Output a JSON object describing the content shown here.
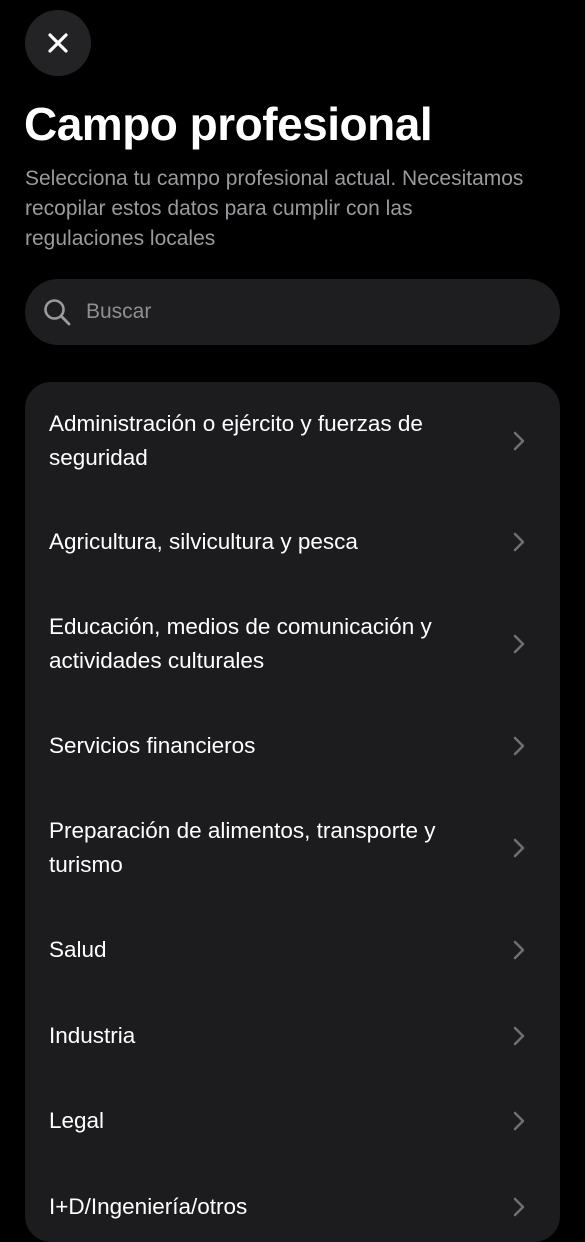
{
  "header": {
    "close_icon": "close-icon",
    "title": "Campo profesional",
    "subtitle": "Selecciona tu campo profesional actual. Necesitamos recopilar estos datos para cumplir con las regulaciones locales"
  },
  "search": {
    "icon": "search-icon",
    "placeholder": "Buscar",
    "value": ""
  },
  "fields": {
    "items": [
      {
        "label": "Administración o ejército y fuerzas de seguridad"
      },
      {
        "label": "Agricultura, silvicultura y pesca"
      },
      {
        "label": "Educación, medios de comunicación y actividades culturales"
      },
      {
        "label": "Servicios financieros"
      },
      {
        "label": "Preparación de alimentos, transporte y turismo"
      },
      {
        "label": "Salud"
      },
      {
        "label": "Industria"
      },
      {
        "label": "Legal"
      },
      {
        "label": "I+D/Ingeniería/otros"
      }
    ],
    "chevron_icon": "chevron-right-icon"
  },
  "colors": {
    "background": "#000000",
    "surface": "#1c1c1e",
    "text_primary": "#ffffff",
    "text_secondary": "#9a9a9f",
    "chevron": "#6e6e73"
  }
}
